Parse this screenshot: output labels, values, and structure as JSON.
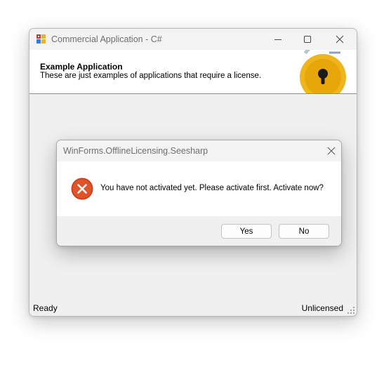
{
  "main_window": {
    "title": "Commercial Application - C#",
    "header": {
      "title": "Example Application",
      "subtitle": "These are just examples of applications that require a license."
    },
    "status_bar": {
      "left": "Ready",
      "right": "Unlicensed"
    }
  },
  "dialog": {
    "title": "WinForms.OfflineLicensing.Seesharp",
    "message": "You have not activated yet. Please activate first. Activate now?",
    "buttons": {
      "yes": "Yes",
      "no": "No"
    }
  },
  "icons": {
    "app": "app-icon",
    "lock": "padlock-icon",
    "error": "error-x-icon",
    "minimize": "minimize-icon",
    "maximize": "maximize-icon",
    "close": "close-icon",
    "grip": "resize-grip-icon"
  },
  "colors": {
    "lock_gold": "#e7a60a",
    "lock_outer": "#f0b41c",
    "error_red": "#d9441c",
    "title_text": "#6e6e6e"
  }
}
